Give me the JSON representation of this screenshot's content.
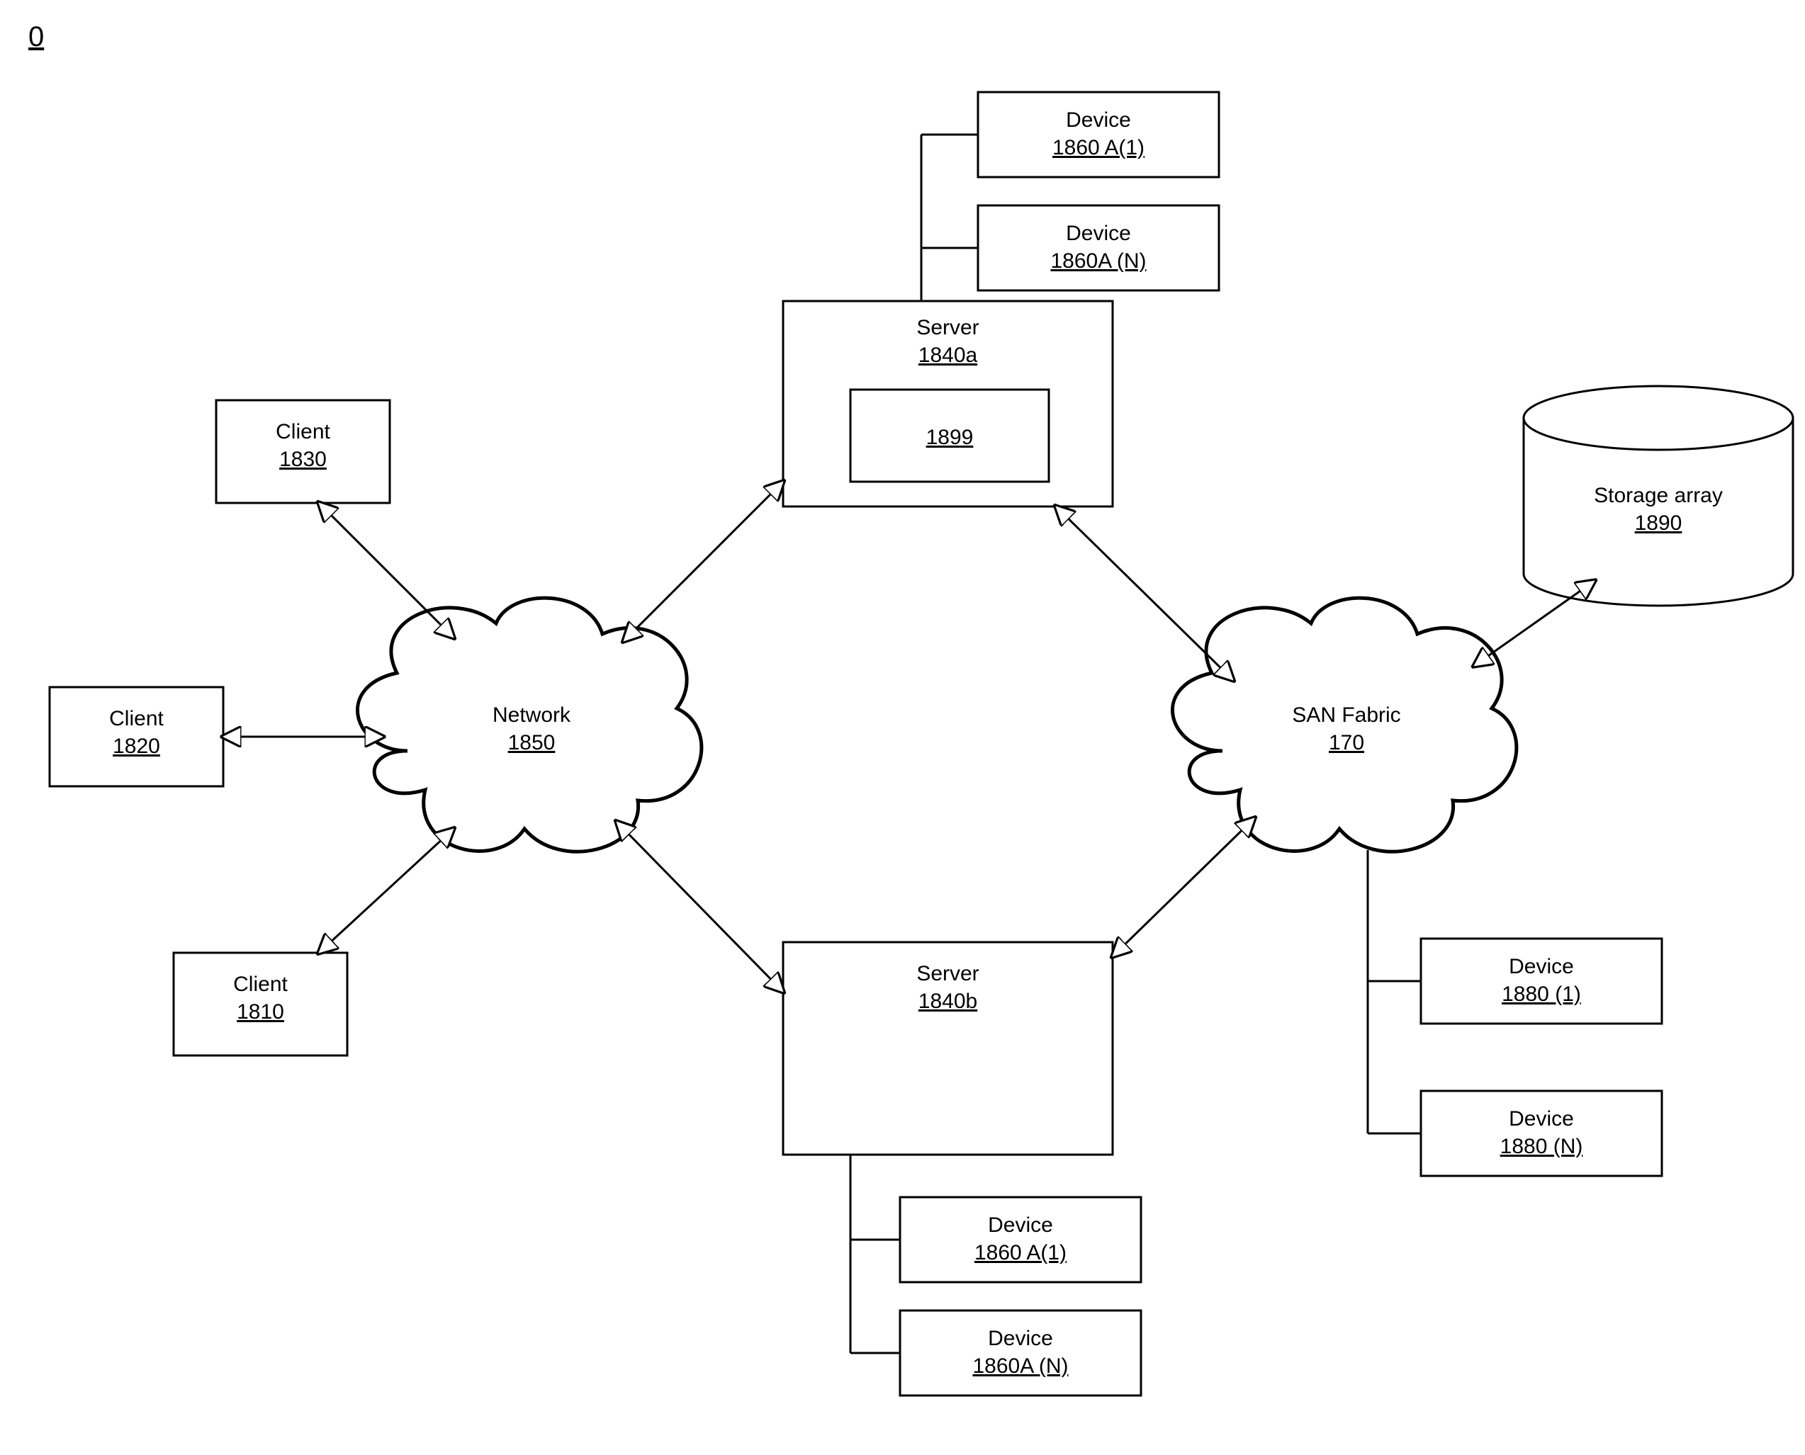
{
  "figure_number": "0",
  "nodes": {
    "client_1830": {
      "title": "Client",
      "id": "1830"
    },
    "client_1820": {
      "title": "Client",
      "id": "1820"
    },
    "client_1810": {
      "title": "Client",
      "id": "1810"
    },
    "network_1850": {
      "title": "Network",
      "id": "1850"
    },
    "server_1840a": {
      "title": "Server",
      "id": "1840a",
      "inner": "1899"
    },
    "server_1840b": {
      "title": "Server",
      "id": "1840b"
    },
    "device_1860a1_top": {
      "title": "Device",
      "id": "1860 A(1)"
    },
    "device_1860an_top": {
      "title": "Device",
      "id": "1860A (N)"
    },
    "device_1860a1_bottom": {
      "title": "Device",
      "id": "1860 A(1)"
    },
    "device_1860an_bottom": {
      "title": "Device",
      "id": "1860A (N)"
    },
    "san_fabric": {
      "title": "SAN Fabric",
      "id": "170"
    },
    "storage_array": {
      "title": "Storage array",
      "id": "1890"
    },
    "device_1880_1": {
      "title": "Device",
      "id": "1880 (1)"
    },
    "device_1880_n": {
      "title": "Device",
      "id": "1880 (N)"
    }
  }
}
